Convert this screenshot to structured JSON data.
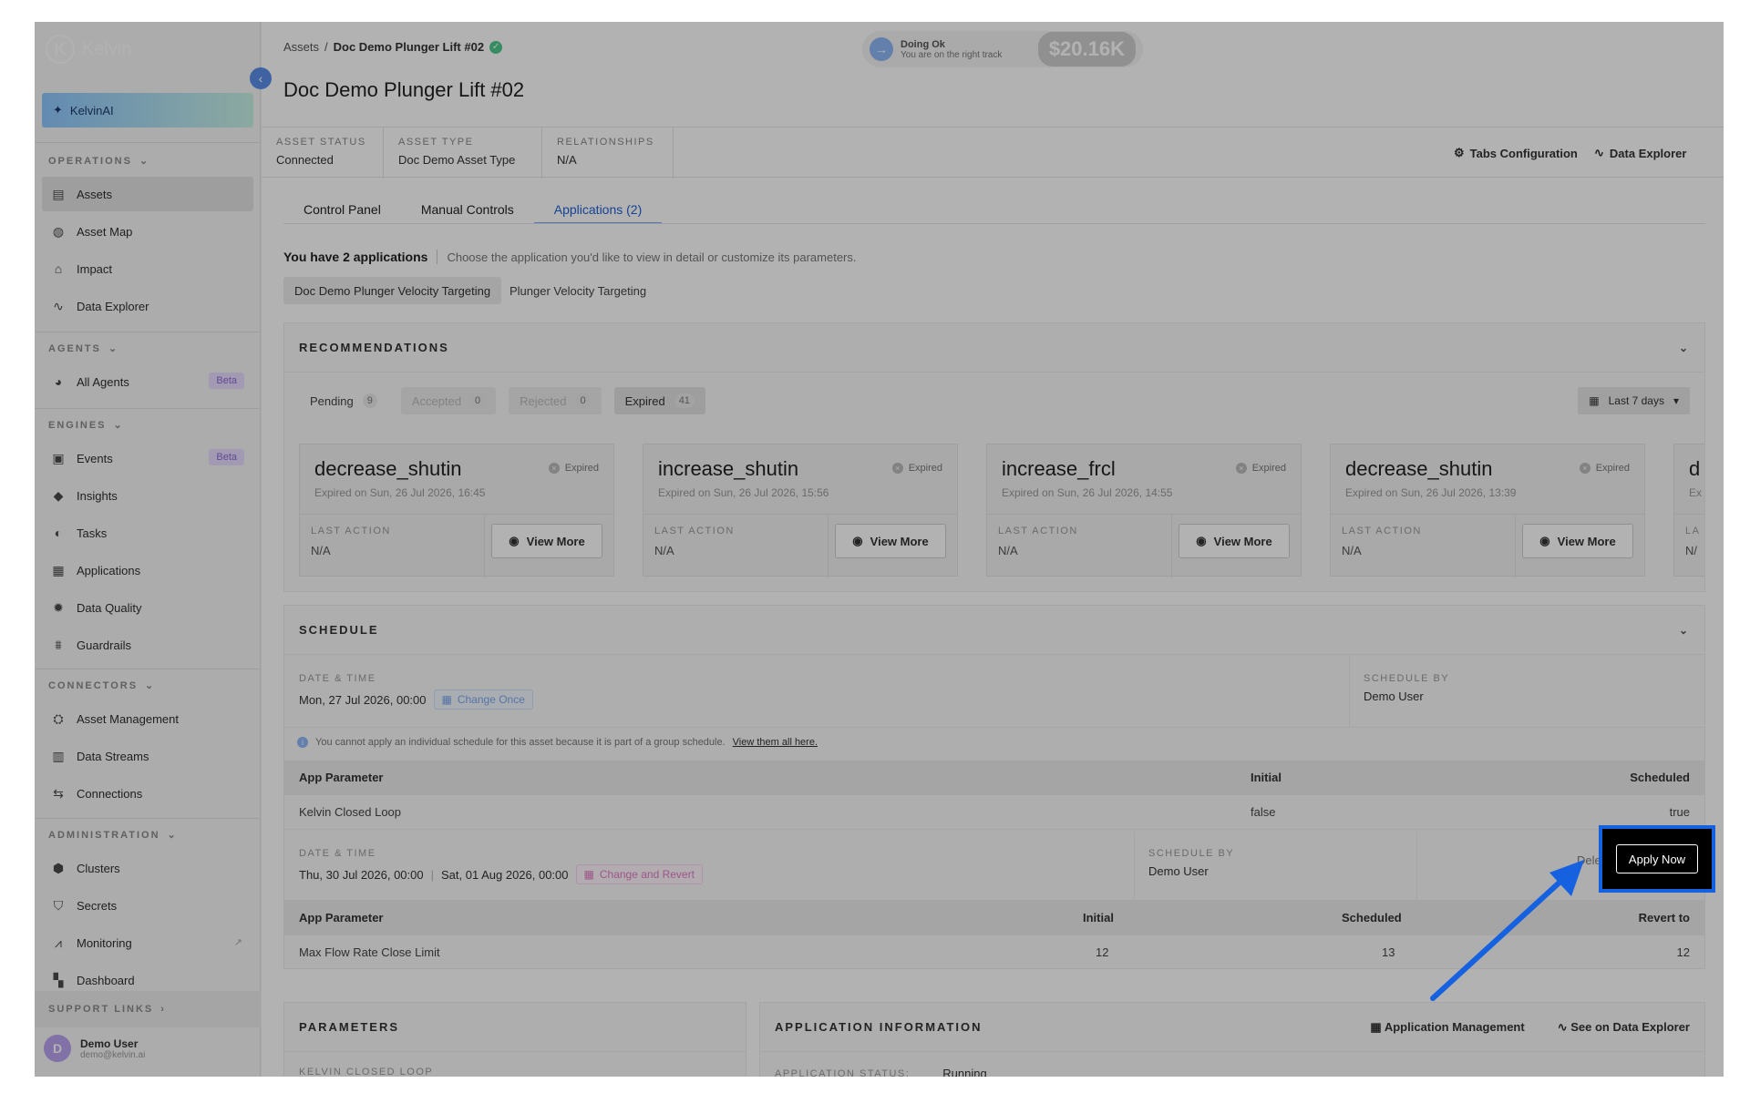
{
  "app": {
    "name": "Kelvin",
    "ai_label": "KelvinAI"
  },
  "sidebar": {
    "sections": [
      {
        "title": "OPERATIONS",
        "items": [
          {
            "label": "Assets",
            "icon": "assets-icon"
          },
          {
            "label": "Asset Map",
            "icon": "globe-icon"
          },
          {
            "label": "Impact",
            "icon": "impact-icon"
          },
          {
            "label": "Data Explorer",
            "icon": "pulse-icon"
          }
        ]
      },
      {
        "title": "AGENTS",
        "items": [
          {
            "label": "All Agents",
            "icon": "agent-icon",
            "badge": "Beta"
          }
        ]
      },
      {
        "title": "ENGINES",
        "items": [
          {
            "label": "Events",
            "icon": "events-icon",
            "badge": "Beta"
          },
          {
            "label": "Insights",
            "icon": "tag-icon"
          },
          {
            "label": "Tasks",
            "icon": "tasks-icon"
          },
          {
            "label": "Applications",
            "icon": "grid-icon"
          },
          {
            "label": "Data Quality",
            "icon": "gear-icon"
          },
          {
            "label": "Guardrails",
            "icon": "guardrail-icon"
          }
        ]
      },
      {
        "title": "CONNECTORS",
        "items": [
          {
            "label": "Asset Management",
            "icon": "asset-mgmt-icon"
          },
          {
            "label": "Data Streams",
            "icon": "bar-chart-icon"
          },
          {
            "label": "Connections",
            "icon": "connection-icon"
          }
        ]
      },
      {
        "title": "ADMINISTRATION",
        "items": [
          {
            "label": "Clusters",
            "icon": "cluster-icon"
          },
          {
            "label": "Secrets",
            "icon": "shield-icon"
          },
          {
            "label": "Monitoring",
            "icon": "monitoring-icon"
          },
          {
            "label": "Dashboard",
            "icon": "dashboard-icon"
          }
        ]
      }
    ],
    "support": "SUPPORT LINKS",
    "user": {
      "name": "Demo User",
      "initial": "D",
      "email": "demo@kelvin.ai"
    }
  },
  "header": {
    "breadcrumb_root": "Assets",
    "breadcrumb_sep": "/",
    "breadcrumb_current": "Doc Demo Plunger Lift #02",
    "title": "Doc Demo Plunger Lift #02",
    "status_title": "Doing Ok",
    "status_sub": "You are on the right track",
    "amount": "$20.16K"
  },
  "info": {
    "asset_status_label": "ASSET STATUS",
    "asset_status": "Connected",
    "asset_type_label": "ASSET TYPE",
    "asset_type": "Doc Demo Asset Type",
    "relationships_label": "RELATIONSHIPS",
    "relationships": "N/A",
    "tabs_config": "Tabs Configuration",
    "data_explorer": "Data Explorer"
  },
  "tabs": [
    "Control Panel",
    "Manual Controls",
    "Applications (2)"
  ],
  "apps": {
    "count_text": "You have 2 applications",
    "hint": "Choose the application you'd like to view in detail or customize its parameters.",
    "buttons": [
      "Doc Demo Plunger Velocity Targeting",
      "Plunger Velocity Targeting"
    ]
  },
  "recommendations": {
    "title": "RECOMMENDATIONS",
    "tabs": [
      {
        "label": "Pending",
        "count": "9"
      },
      {
        "label": "Accepted",
        "count": "0"
      },
      {
        "label": "Rejected",
        "count": "0"
      },
      {
        "label": "Expired",
        "count": "41"
      }
    ],
    "range": "Last 7 days",
    "last_action_label": "LAST ACTION",
    "view_more": "View More",
    "cards": [
      {
        "name": "decrease_shutin",
        "status": "Expired",
        "date": "Expired on Sun, 26 Jul 2026, 16:45",
        "last_action": "N/A"
      },
      {
        "name": "increase_shutin",
        "status": "Expired",
        "date": "Expired on Sun, 26 Jul 2026, 15:56",
        "last_action": "N/A"
      },
      {
        "name": "increase_frcl",
        "status": "Expired",
        "date": "Expired on Sun, 26 Jul 2026, 14:55",
        "last_action": "N/A"
      },
      {
        "name": "decrease_shutin",
        "status": "Expired",
        "date": "Expired on Sun, 26 Jul 2026, 13:39",
        "last_action": "N/A"
      }
    ],
    "partial_name": "d",
    "partial_date": "Ex",
    "partial_la": "LA",
    "partial_na": "N/"
  },
  "schedule": {
    "title": "SCHEDULE",
    "dt_label": "DATE & TIME",
    "by_label": "SCHEDULE BY",
    "s1_date": "Mon, 27 Jul 2026, 00:00",
    "s1_btn": "Change Once",
    "s1_by": "Demo User",
    "note": "You cannot apply an individual schedule for this asset because it is part of a group schedule.",
    "note_link": "View them all here.",
    "t1_headers": [
      "App Parameter",
      "Initial",
      "Scheduled"
    ],
    "t1_row": [
      "Kelvin Closed Loop",
      "false",
      "true"
    ],
    "s2_date_from": "Thu, 30 Jul 2026, 00:00",
    "s2_date_to": "Sat, 01 Aug 2026, 00:00",
    "s2_btn": "Change and Revert",
    "s2_by": "Demo User",
    "delete": "Delete",
    "apply": "Apply Now",
    "t2_headers": [
      "App Parameter",
      "Initial",
      "Scheduled",
      "Revert to"
    ],
    "t2_row": [
      "Max Flow Rate Close Limit",
      "12",
      "13",
      "12"
    ]
  },
  "parameters": {
    "title": "PARAMETERS",
    "field_label": "KELVIN CLOSED LOOP"
  },
  "app_info": {
    "title": "APPLICATION INFORMATION",
    "mgmt": "Application Management",
    "explorer": "See on Data Explorer",
    "status_label": "APPLICATION STATUS:",
    "status": "Running"
  }
}
